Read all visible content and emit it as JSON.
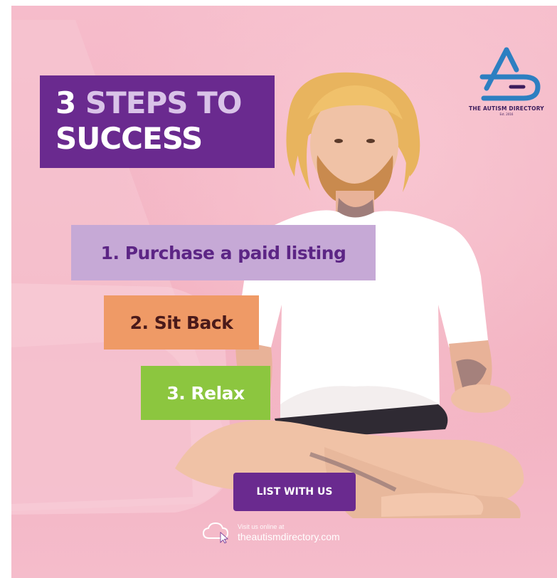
{
  "title": {
    "number": "3",
    "word1": "STEPS TO",
    "word2": "SUCCESS"
  },
  "steps": [
    {
      "label": "1. Purchase a paid listing"
    },
    {
      "label": "2. Sit Back"
    },
    {
      "label": "3. Relax"
    }
  ],
  "cta": {
    "label": "LIST WITH US"
  },
  "footer": {
    "visit_label": "Visit us online at",
    "url": "theautismdirectory.com",
    "icon": "cloud-cursor-icon"
  },
  "logo": {
    "name": "THE AUTISM DIRECTORY",
    "est": "Est. 2016",
    "icon": "autism-directory-logo"
  },
  "colors": {
    "background": "#f4b7c5",
    "purple": "#6a2a8f",
    "lavender": "#c6a9d6",
    "orange": "#ef9a66",
    "green": "#8cc63f",
    "logo_blue": "#2d7fc1"
  }
}
